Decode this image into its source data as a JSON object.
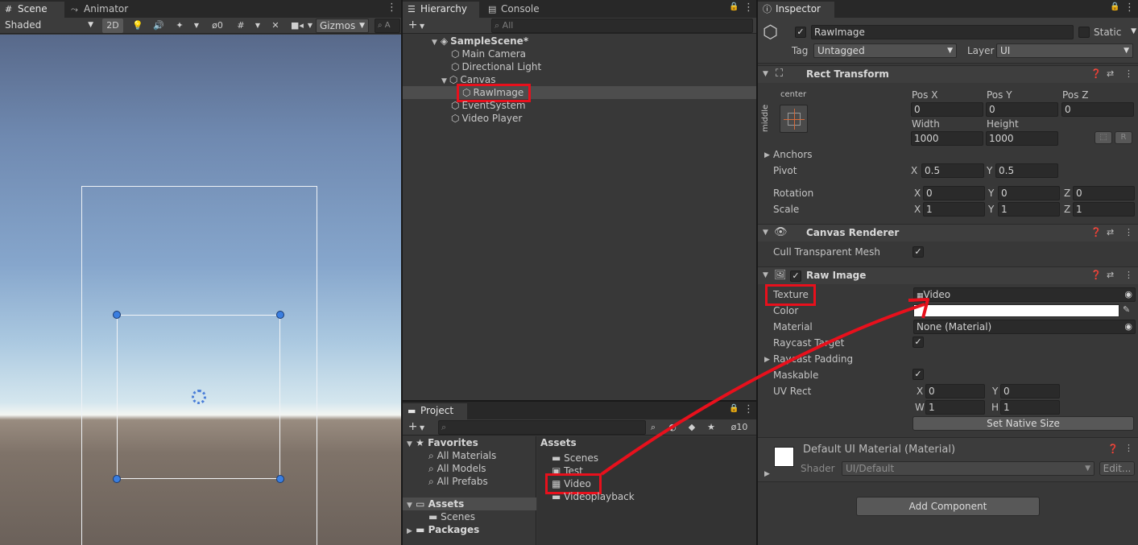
{
  "scene": {
    "tabs": [
      "Scene",
      "Animator"
    ],
    "shading": "Shaded",
    "mode_2d": "2D",
    "hidden_count": "0",
    "gizmos": "Gizmos",
    "search_hint": "A"
  },
  "hierarchy": {
    "tabs": [
      "Hierarchy",
      "Console"
    ],
    "search_placeholder": "All",
    "add_label": "+",
    "items": [
      {
        "name": "SampleScene*"
      },
      {
        "name": "Main Camera"
      },
      {
        "name": "Directional Light"
      },
      {
        "name": "Canvas"
      },
      {
        "name": "RawImage"
      },
      {
        "name": "EventSystem"
      },
      {
        "name": "Video Player"
      }
    ]
  },
  "project": {
    "tab": "Project",
    "add_label": "+",
    "hidden_count": "10",
    "tree": {
      "favorites": "Favorites",
      "favorites_items": [
        "All Materials",
        "All Models",
        "All Prefabs"
      ],
      "assets": "Assets",
      "assets_items": [
        "Scenes"
      ],
      "packages": "Packages"
    },
    "breadcrumb": "Assets",
    "assets": [
      "Scenes",
      "Test",
      "Video",
      "Videoplayback"
    ]
  },
  "inspector": {
    "tab": "Inspector",
    "object_name": "RawImage",
    "static_label": "Static",
    "tag_label": "Tag",
    "tag_value": "Untagged",
    "layer_label": "Layer",
    "layer_value": "UI",
    "rect_transform": {
      "title": "Rect Transform",
      "anchor_h": "center",
      "anchor_v": "middle",
      "posx_label": "Pos X",
      "posx": "0",
      "posy_label": "Pos Y",
      "posy": "0",
      "posz_label": "Pos Z",
      "posz": "0",
      "width_label": "Width",
      "width": "1000",
      "height_label": "Height",
      "height": "1000",
      "r_label": "R",
      "anchors_label": "Anchors",
      "pivot_label": "Pivot",
      "pivot_x": "0.5",
      "pivot_y": "0.5",
      "rotation_label": "Rotation",
      "rot_x": "0",
      "rot_y": "0",
      "rot_z": "0",
      "scale_label": "Scale",
      "scale_x": "1",
      "scale_y": "1",
      "scale_z": "1",
      "x": "X",
      "y": "Y",
      "z": "Z"
    },
    "canvas_renderer": {
      "title": "Canvas Renderer",
      "cull_label": "Cull Transparent Mesh"
    },
    "raw_image": {
      "title": "Raw Image",
      "texture_label": "Texture",
      "texture_value": "Video",
      "color_label": "Color",
      "material_label": "Material",
      "material_value": "None (Material)",
      "raycast_target_label": "Raycast Target",
      "raycast_padding_label": "Raycast Padding",
      "maskable_label": "Maskable",
      "uvrect_label": "UV Rect",
      "uv_x": "0",
      "uv_y": "0",
      "uv_w": "1",
      "uv_h": "1",
      "x": "X",
      "y": "Y",
      "w": "W",
      "h": "H",
      "set_native_size": "Set Native Size"
    },
    "material": {
      "title": "Default UI Material (Material)",
      "shader_label": "Shader",
      "shader_value": "UI/Default",
      "edit_label": "Edit..."
    },
    "add_component": "Add Component"
  },
  "colors": {
    "annotation_red": "#e8101c",
    "handle_blue": "#3a7ee0"
  }
}
